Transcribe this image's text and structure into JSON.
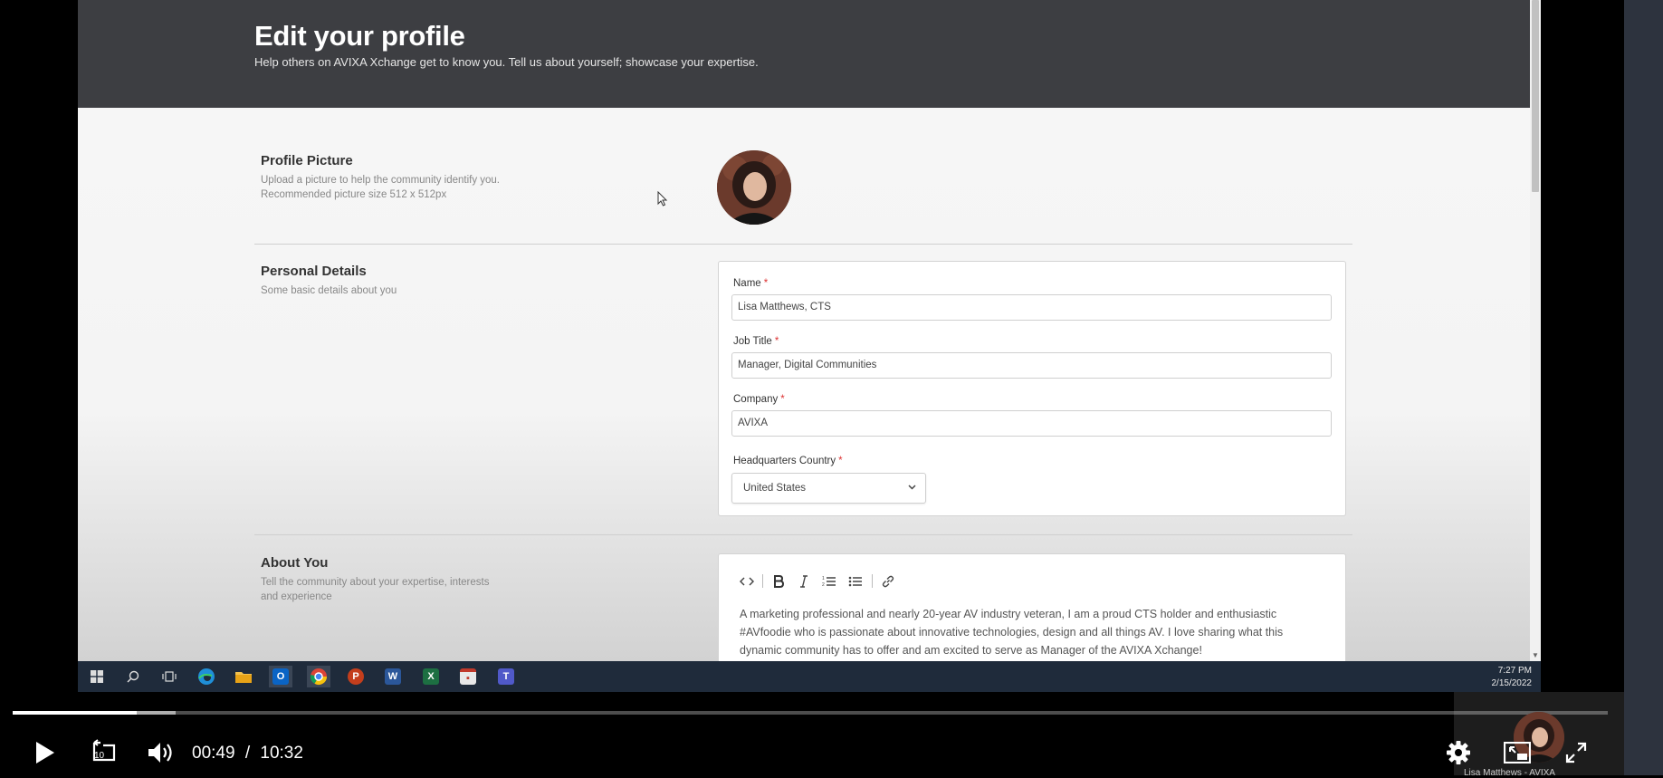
{
  "page": {
    "title": "Edit your profile",
    "subtitle": "Help others on AVIXA Xchange get to know you. Tell us about yourself; showcase your expertise."
  },
  "profile_picture": {
    "title": "Profile Picture",
    "description": "Upload a picture to help the community identify you. Recommended picture size 512 x 512px"
  },
  "personal_details": {
    "title": "Personal Details",
    "description": "Some basic details about you",
    "required_marker": "*",
    "name": {
      "label": "Name",
      "value": "Lisa Matthews, CTS"
    },
    "job_title": {
      "label": "Job Title",
      "value": "Manager, Digital Communities"
    },
    "company": {
      "label": "Company",
      "value": "AVIXA"
    },
    "hq_country": {
      "label": "Headquarters Country",
      "value": "United States"
    }
  },
  "about_you": {
    "title": "About You",
    "description": "Tell the community about your expertise, interests and experience",
    "toolbar": [
      "code-icon",
      "bold-icon",
      "italic-icon",
      "numbered-list-icon",
      "bulleted-list-icon",
      "link-icon"
    ],
    "text": "A marketing professional and nearly 20-year AV industry veteran, I am a proud CTS holder and enthusiastic #AVfoodie who is passionate about innovative technologies, design and all things AV. I love sharing what this dynamic community has to offer and am excited to serve as Manager of the AVIXA Xchange!"
  },
  "taskbar": {
    "apps": [
      "windows-start-icon",
      "search-icon",
      "task-view-icon",
      "edge-icon",
      "file-explorer-icon",
      "outlook-icon",
      "chrome-icon",
      "powerpoint-icon",
      "word-icon",
      "excel-icon",
      "calendar-app-icon",
      "teams-icon"
    ],
    "time": "7:27 PM",
    "date": "2/15/2022"
  },
  "player": {
    "current_time": "00:49",
    "separator": "/",
    "duration": "10:32",
    "rewind_seconds": "10",
    "progress_fraction": 0.078,
    "buffered_fraction": 0.102,
    "presenter_name": "Lisa Matthews - AVIXA"
  },
  "colors": {
    "hero_bg": "#3d3e42",
    "taskbar_bg": "#1f2b3b",
    "required": "#dd3333"
  }
}
